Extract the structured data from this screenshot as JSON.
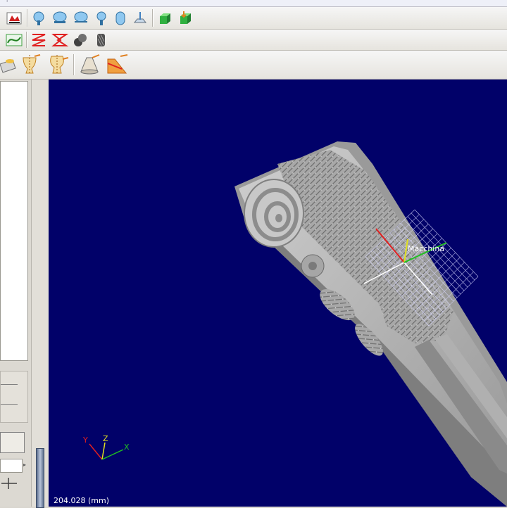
{
  "title_fragment": "?",
  "toolbars": {
    "row1": [
      "cam-job-icon",
      "tool-head-1-icon",
      "tool-head-2-icon",
      "tool-head-3-icon",
      "tool-head-4-icon",
      "tool-head-5-icon",
      "surface-plane-icon",
      "green-box-icon",
      "green-box-down-icon"
    ],
    "row2": [
      "surface-profile-icon",
      "toolpath-zigzag-icon",
      "toolpath-star-icon",
      "cylinder-icon",
      "ribbed-cylinder-icon"
    ],
    "row3": [
      "flat-surface-icon",
      "goblet-rotary-icon",
      "vase-rotary-icon",
      "cone-icon",
      "angled-face-icon"
    ]
  },
  "viewport": {
    "background": "#010169",
    "machine_label": "Macchina",
    "axis_labels": {
      "y": "Y",
      "z": "Z",
      "x": "X"
    },
    "readout": "204.028 (mm)"
  },
  "colors": {
    "axis_x": "#20c020",
    "axis_y": "#e02020",
    "axis_z": "#e0e020",
    "model": "#b4b4b4"
  }
}
